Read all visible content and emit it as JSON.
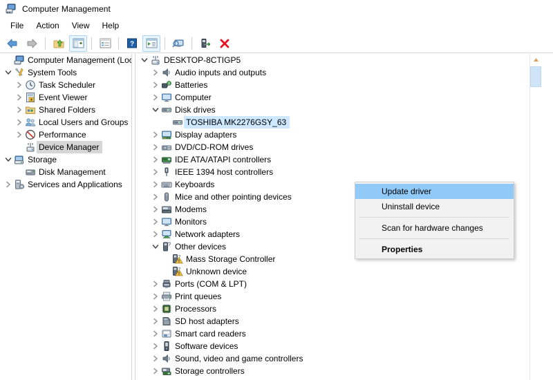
{
  "window": {
    "title": "Computer Management",
    "icon": "computer-management-icon"
  },
  "menubar": {
    "items": [
      {
        "label": "File"
      },
      {
        "label": "Action"
      },
      {
        "label": "View"
      },
      {
        "label": "Help"
      }
    ]
  },
  "toolbar": {
    "buttons": [
      {
        "name": "back-button",
        "icon": "arrow-left-icon",
        "framed": false
      },
      {
        "name": "forward-button",
        "icon": "arrow-right-icon",
        "framed": false
      },
      {
        "name": "up-one-level-button",
        "icon": "folder-up-icon",
        "framed": false
      },
      {
        "name": "show-hide-console-tree-button",
        "icon": "console-tree-icon",
        "framed": true
      },
      {
        "name": "properties-button",
        "icon": "properties-window-icon",
        "framed": false
      },
      {
        "name": "help-button",
        "icon": "question-mark-icon",
        "framed": false
      },
      {
        "name": "show-hide-action-pane-button",
        "icon": "action-pane-icon",
        "framed": true
      },
      {
        "name": "scan-hardware-changes-button",
        "icon": "monitor-search-icon",
        "framed": false
      },
      {
        "name": "update-driver-button",
        "icon": "update-driver-icon",
        "framed": false
      },
      {
        "name": "uninstall-device-button",
        "icon": "red-x-icon",
        "framed": false
      }
    ]
  },
  "console_tree": {
    "nodes": [
      {
        "label": "Computer Management (Local",
        "icon": "computer-icon",
        "indent": 0,
        "expander": "none",
        "selected": false
      },
      {
        "label": "System Tools",
        "icon": "system-tools-icon",
        "indent": 0,
        "expander": "expanded",
        "selected": false
      },
      {
        "label": "Task Scheduler",
        "icon": "clock-icon",
        "indent": 1,
        "expander": "collapsed",
        "selected": false
      },
      {
        "label": "Event Viewer",
        "icon": "event-viewer-icon",
        "indent": 1,
        "expander": "collapsed",
        "selected": false
      },
      {
        "label": "Shared Folders",
        "icon": "shared-folders-icon",
        "indent": 1,
        "expander": "collapsed",
        "selected": false
      },
      {
        "label": "Local Users and Groups",
        "icon": "users-group-icon",
        "indent": 1,
        "expander": "collapsed",
        "selected": false
      },
      {
        "label": "Performance",
        "icon": "performance-icon",
        "indent": 1,
        "expander": "collapsed",
        "selected": false
      },
      {
        "label": "Device Manager",
        "icon": "device-manager-icon",
        "indent": 1,
        "expander": "none",
        "selected": true
      },
      {
        "label": "Storage",
        "icon": "storage-icon",
        "indent": 0,
        "expander": "expanded",
        "selected": false
      },
      {
        "label": "Disk Management",
        "icon": "disk-management-icon",
        "indent": 1,
        "expander": "none",
        "selected": false
      },
      {
        "label": "Services and Applications",
        "icon": "services-icon",
        "indent": 0,
        "expander": "collapsed",
        "selected": false
      }
    ]
  },
  "device_tree": {
    "nodes": [
      {
        "label": "DESKTOP-8CTIGP5",
        "icon": "device-manager-icon",
        "indent": 0,
        "expander": "expanded",
        "selected": false
      },
      {
        "label": "Audio inputs and outputs",
        "icon": "speaker-icon",
        "indent": 1,
        "expander": "collapsed",
        "selected": false
      },
      {
        "label": "Batteries",
        "icon": "battery-icon",
        "indent": 1,
        "expander": "collapsed",
        "selected": false
      },
      {
        "label": "Computer",
        "icon": "monitor-icon",
        "indent": 1,
        "expander": "collapsed",
        "selected": false
      },
      {
        "label": "Disk drives",
        "icon": "disk-drive-icon",
        "indent": 1,
        "expander": "expanded",
        "selected": false
      },
      {
        "label": "TOSHIBA MK2276GSY_63",
        "icon": "disk-drive-icon",
        "indent": 2,
        "expander": "none",
        "selected": true
      },
      {
        "label": "Display adapters",
        "icon": "display-adapter-icon",
        "indent": 1,
        "expander": "collapsed",
        "selected": false
      },
      {
        "label": "DVD/CD-ROM drives",
        "icon": "dvd-drive-icon",
        "indent": 1,
        "expander": "collapsed",
        "selected": false
      },
      {
        "label": "IDE ATA/ATAPI controllers",
        "icon": "ide-controller-icon",
        "indent": 1,
        "expander": "collapsed",
        "selected": false
      },
      {
        "label": "IEEE 1394 host controllers",
        "icon": "firewire-icon",
        "indent": 1,
        "expander": "collapsed",
        "selected": false
      },
      {
        "label": "Keyboards",
        "icon": "keyboard-icon",
        "indent": 1,
        "expander": "collapsed",
        "selected": false
      },
      {
        "label": "Mice and other pointing devices",
        "icon": "mouse-icon",
        "indent": 1,
        "expander": "collapsed",
        "selected": false
      },
      {
        "label": "Modems",
        "icon": "modem-icon",
        "indent": 1,
        "expander": "collapsed",
        "selected": false
      },
      {
        "label": "Monitors",
        "icon": "monitor-icon",
        "indent": 1,
        "expander": "collapsed",
        "selected": false
      },
      {
        "label": "Network adapters",
        "icon": "network-adapter-icon",
        "indent": 1,
        "expander": "collapsed",
        "selected": false
      },
      {
        "label": "Other devices",
        "icon": "other-devices-icon",
        "indent": 1,
        "expander": "expanded",
        "selected": false
      },
      {
        "label": "Mass Storage Controller",
        "icon": "unknown-device-warning-icon",
        "indent": 2,
        "expander": "none",
        "selected": false
      },
      {
        "label": "Unknown device",
        "icon": "unknown-device-warning-icon",
        "indent": 2,
        "expander": "none",
        "selected": false
      },
      {
        "label": "Ports (COM & LPT)",
        "icon": "port-icon",
        "indent": 1,
        "expander": "collapsed",
        "selected": false
      },
      {
        "label": "Print queues",
        "icon": "printer-icon",
        "indent": 1,
        "expander": "collapsed",
        "selected": false
      },
      {
        "label": "Processors",
        "icon": "processor-icon",
        "indent": 1,
        "expander": "collapsed",
        "selected": false
      },
      {
        "label": "SD host adapters",
        "icon": "sd-card-icon",
        "indent": 1,
        "expander": "collapsed",
        "selected": false
      },
      {
        "label": "Smart card readers",
        "icon": "smart-card-reader-icon",
        "indent": 1,
        "expander": "collapsed",
        "selected": false
      },
      {
        "label": "Software devices",
        "icon": "software-device-icon",
        "indent": 1,
        "expander": "collapsed",
        "selected": false
      },
      {
        "label": "Sound, video and game controllers",
        "icon": "speaker-icon",
        "indent": 1,
        "expander": "collapsed",
        "selected": false
      },
      {
        "label": "Storage controllers",
        "icon": "storage-controller-icon",
        "indent": 1,
        "expander": "collapsed",
        "selected": false
      }
    ]
  },
  "context_menu": {
    "items": [
      {
        "label": "Update driver",
        "highlighted": true,
        "bold": false,
        "separator_after": false
      },
      {
        "label": "Uninstall device",
        "highlighted": false,
        "bold": false,
        "separator_after": true
      },
      {
        "label": "Scan for hardware changes",
        "highlighted": false,
        "bold": false,
        "separator_after": true
      },
      {
        "label": "Properties",
        "highlighted": false,
        "bold": true,
        "separator_after": false
      }
    ]
  },
  "scrollbar": {
    "up_arrow": "scroll-up-arrow-icon",
    "name": "device-tree-vertical-scrollbar"
  },
  "colors": {
    "selection_blue": "#cde8ff",
    "menu_highlight": "#91c9f7",
    "soft_selection": "#d6d6d6",
    "toolbar_frame": "#a9d4f2",
    "red_x": "#e81123"
  }
}
